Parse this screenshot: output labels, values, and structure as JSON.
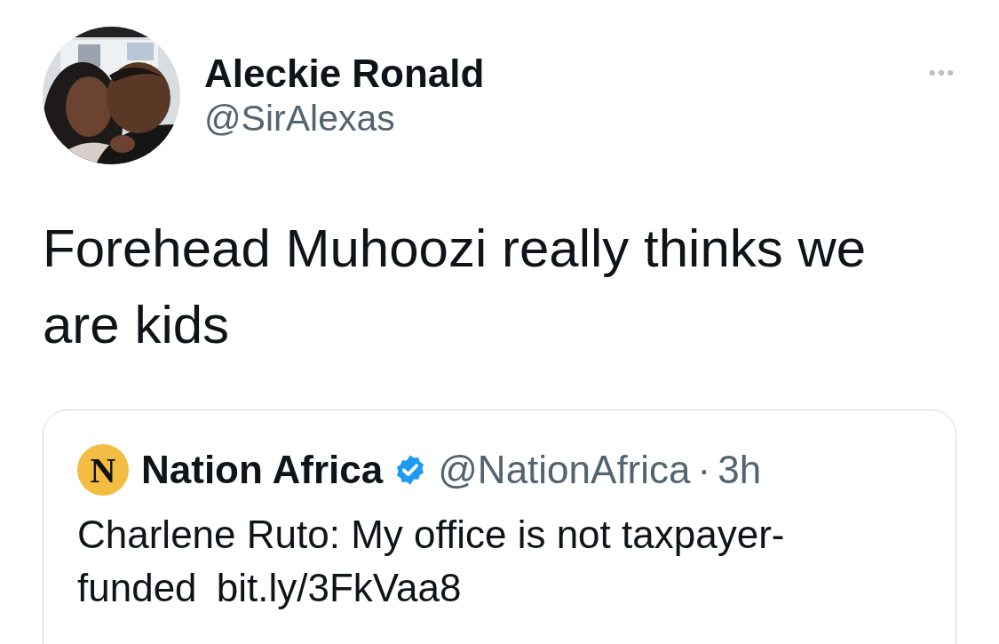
{
  "tweet": {
    "author": {
      "name": "Aleckie Ronald",
      "handle": "@SirAlexas"
    },
    "text": "Forehead Muhoozi really thinks we are kids",
    "quoted_tweet": {
      "logo_letter": "N",
      "name": "Nation Africa",
      "verified": true,
      "handle": "@NationAfrica",
      "separator": "·",
      "time": "3h",
      "text": "Charlene Ruto: My office is not taxpayer-funded",
      "link": "bit.ly/3FkVaa8"
    }
  }
}
